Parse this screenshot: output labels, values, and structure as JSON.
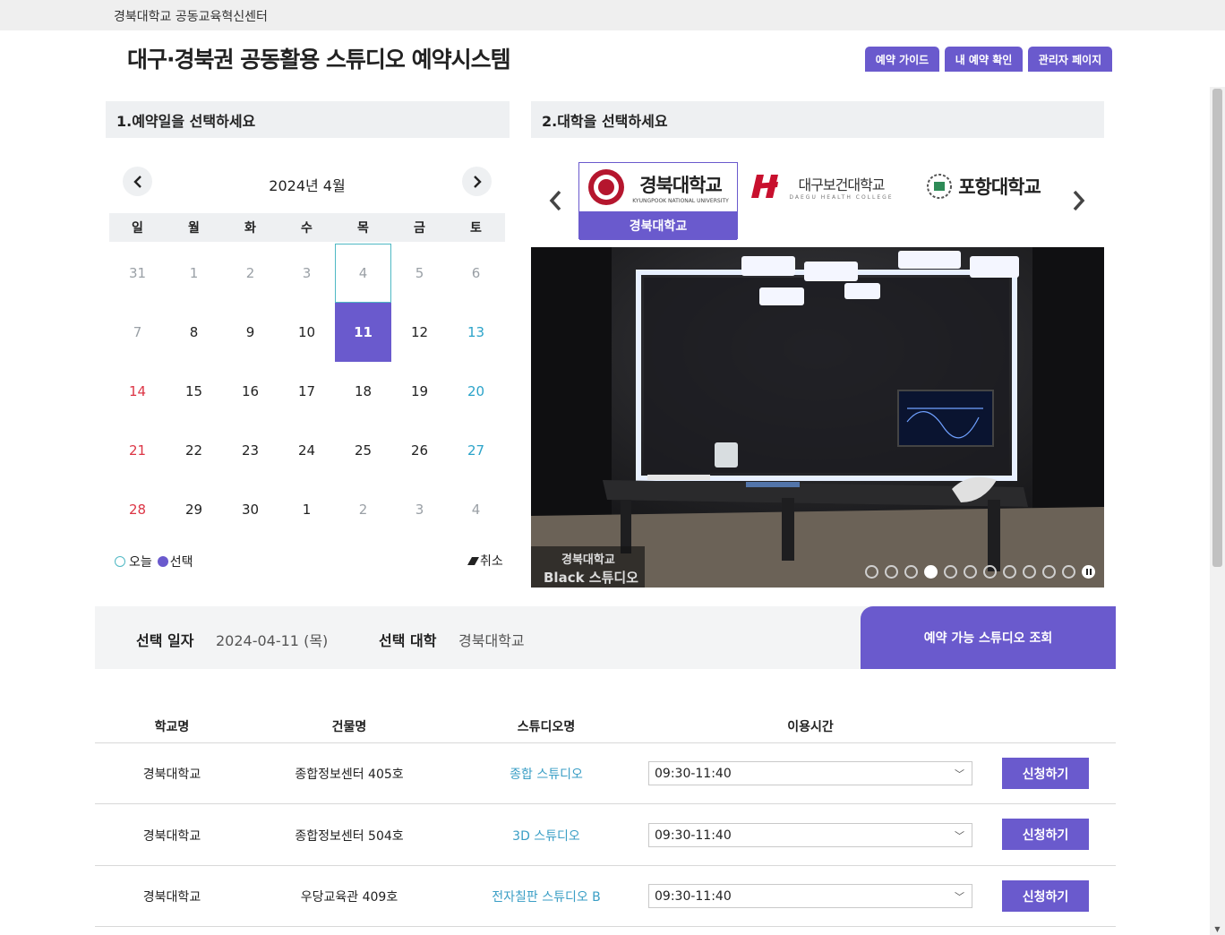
{
  "header": {
    "org_name": "경북대학교 공동교육혁신센터",
    "site_title": "대구·경북권 공동활용 스튜디오 예약시스템",
    "buttons": [
      "예약 가이드",
      "내 예약 확인",
      "관리자 페이지"
    ]
  },
  "calendar": {
    "section_title": "1.예약일을 선택하세요",
    "month_label": "2024년 4월",
    "prev_icon": "chevron-left-icon",
    "next_icon": "chevron-right-icon",
    "weekdays": [
      "일",
      "월",
      "화",
      "수",
      "목",
      "금",
      "토"
    ],
    "weeks": [
      [
        "31",
        "1",
        "2",
        "3",
        "4",
        "5",
        "6"
      ],
      [
        "7",
        "8",
        "9",
        "10",
        "11",
        "12",
        "13"
      ],
      [
        "14",
        "15",
        "16",
        "17",
        "18",
        "19",
        "20"
      ],
      [
        "21",
        "22",
        "23",
        "24",
        "25",
        "26",
        "27"
      ],
      [
        "28",
        "29",
        "30",
        "1",
        "2",
        "3",
        "4"
      ]
    ],
    "legend_today": "오늘",
    "legend_selected": "선택",
    "cancel_label": "취소",
    "colors": {
      "accent": "#6a5acd",
      "today_border": "#4fb8c4",
      "sunday": "#dc3545",
      "saturday": "#2ba3c9"
    }
  },
  "university": {
    "section_title": "2.대학을 선택하세요",
    "items": [
      {
        "logo_text": "경북대학교",
        "logo_sub": "KYUNGPOOK NATIONAL UNIVERSITY",
        "label": "경북대학교"
      },
      {
        "logo_text": "대구보건대학교",
        "logo_sub": "DAEGU HEALTH COLLEGE"
      },
      {
        "logo_text": "포항대학교"
      }
    ],
    "photo_caption_1": "경북대학교",
    "photo_caption_2": "Black 스튜디오",
    "slide_count": 11,
    "active_slide": 4
  },
  "selection": {
    "date_label": "선택 일자",
    "date_value": "2024-04-11 (목)",
    "uni_label": "선택 대학",
    "uni_value": "경북대학교",
    "search_button": "예약 가능 스튜디오 조회"
  },
  "table": {
    "headers": [
      "학교명",
      "건물명",
      "스튜디오명",
      "이용시간"
    ],
    "rows": [
      {
        "school": "경북대학교",
        "building": "종합정보센터 405호",
        "studio": "종합 스튜디오",
        "time": "09:30-11:40",
        "action": "신청하기"
      },
      {
        "school": "경북대학교",
        "building": "종합정보센터 504호",
        "studio": "3D 스튜디오",
        "time": "09:30-11:40",
        "action": "신청하기"
      },
      {
        "school": "경북대학교",
        "building": "우당교육관 409호",
        "studio": "전자칠판 스튜디오 B",
        "time": "09:30-11:40",
        "action": "신청하기"
      }
    ]
  }
}
